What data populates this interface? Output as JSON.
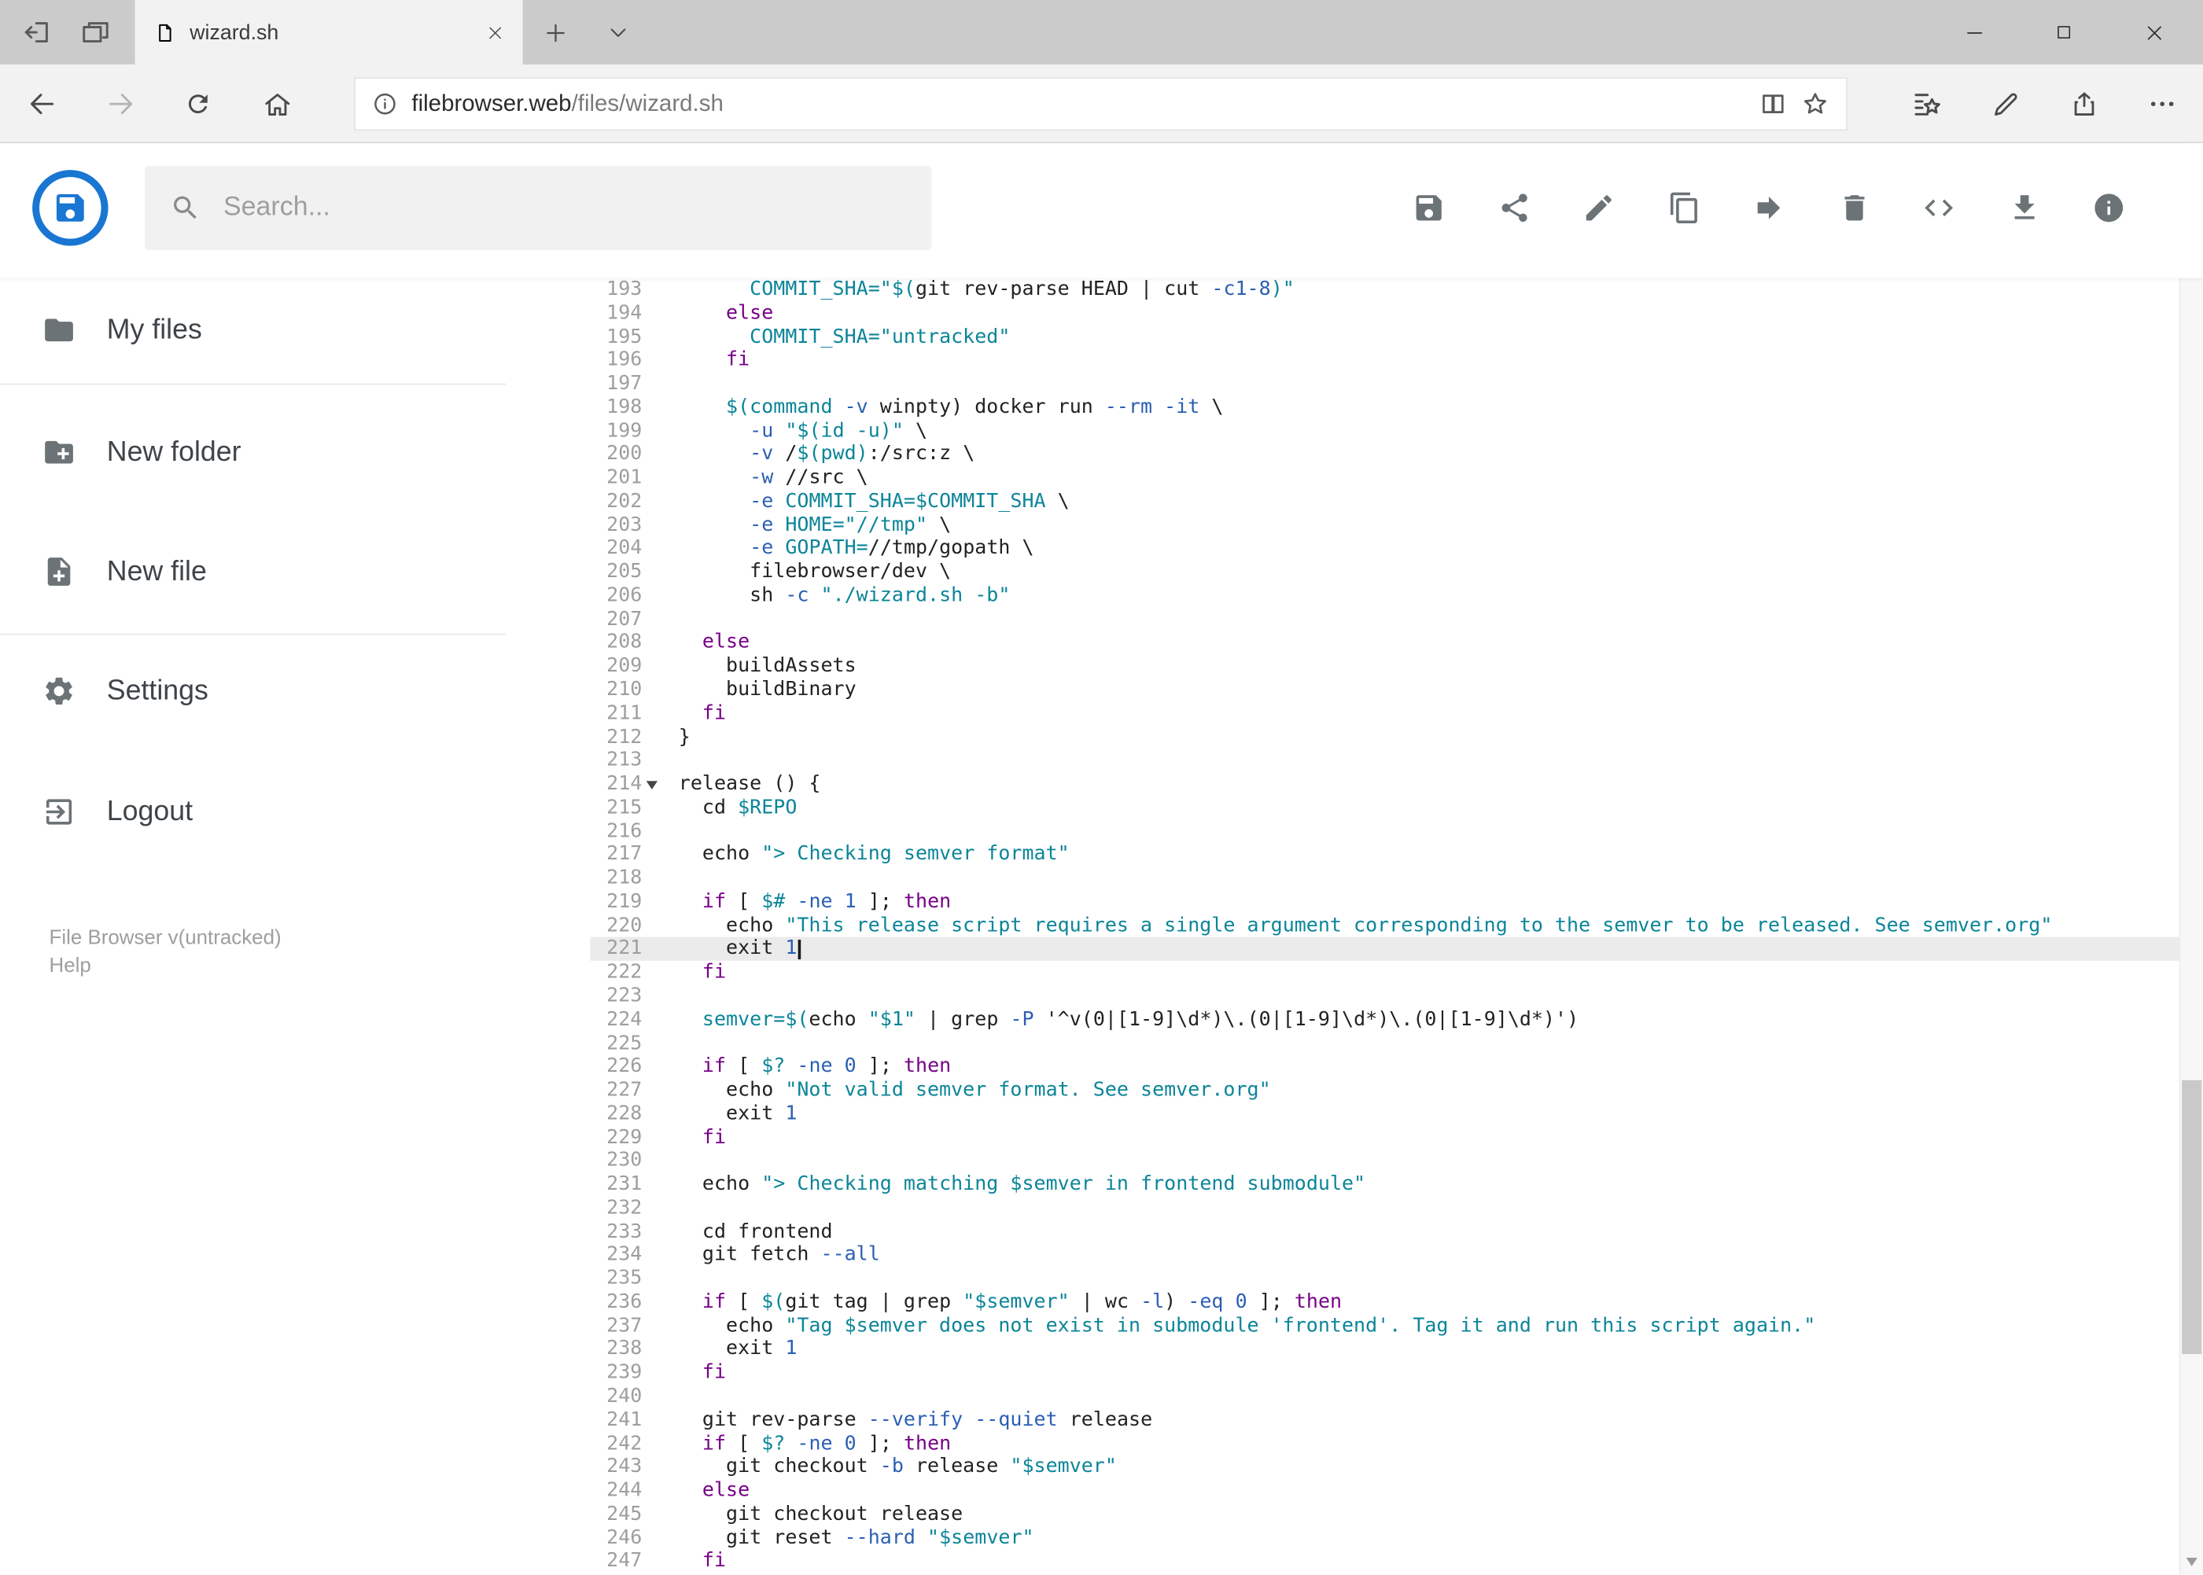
{
  "window": {
    "tab_title": "wizard.sh",
    "control_icons": [
      "minimize",
      "maximize",
      "close"
    ]
  },
  "browser": {
    "url_host": "filebrowser.web",
    "url_path": "/files/wizard.sh",
    "nav_icons": [
      "back",
      "forward",
      "refresh",
      "home"
    ],
    "urlbar_icons": [
      "page-info",
      "reading-view",
      "favorite-star"
    ],
    "action_icons": [
      "hub",
      "web-note",
      "share",
      "more"
    ],
    "tabstrip_icons": [
      "set-tabs-aside",
      "tab-preview",
      "new-tab",
      "tab-list-chevron"
    ]
  },
  "app": {
    "logo_color": "#1976d2",
    "search": {
      "placeholder": "Search..."
    },
    "toolbar_icons": [
      "save",
      "share",
      "rename",
      "copy",
      "move",
      "delete",
      "raw-editor",
      "download",
      "info"
    ],
    "sidebar": {
      "items": [
        {
          "icon": "folder",
          "label": "My files"
        },
        {
          "icon": "new-folder",
          "label": "New folder"
        },
        {
          "icon": "new-file",
          "label": "New file"
        },
        {
          "icon": "settings",
          "label": "Settings"
        },
        {
          "icon": "logout",
          "label": "Logout"
        }
      ],
      "footer": {
        "version": "File Browser v(untracked)",
        "help": "Help"
      }
    }
  },
  "editor": {
    "language": "shell",
    "active_line": 221,
    "fold_marker_line": 214,
    "colors": {
      "plain": "#222222",
      "keyword": "#770088",
      "string": "#0c8599",
      "variable": "#0c8599",
      "attribute": "#2b5fb3",
      "number": "#2b5fb3",
      "gutter": "#9e9e9e",
      "active_line_bg": "#ebebeb"
    },
    "lines": [
      {
        "n": 193,
        "s": [
          [
            "p",
            "      "
          ],
          [
            "v",
            "COMMIT_SHA="
          ],
          [
            "s",
            "\"$("
          ],
          [
            "p",
            "git rev-parse HEAD | cut "
          ],
          [
            "a",
            "-c1-8"
          ],
          [
            "s",
            ")\""
          ]
        ]
      },
      {
        "n": 194,
        "s": [
          [
            "p",
            "    "
          ],
          [
            "k",
            "else"
          ]
        ]
      },
      {
        "n": 195,
        "s": [
          [
            "p",
            "      "
          ],
          [
            "v",
            "COMMIT_SHA="
          ],
          [
            "s",
            "\"untracked\""
          ]
        ]
      },
      {
        "n": 196,
        "s": [
          [
            "p",
            "    "
          ],
          [
            "k",
            "fi"
          ]
        ]
      },
      {
        "n": 197,
        "s": []
      },
      {
        "n": 198,
        "s": [
          [
            "p",
            "    "
          ],
          [
            "v",
            "$(command"
          ],
          [
            "p",
            " "
          ],
          [
            "a",
            "-v"
          ],
          [
            "p",
            " winpty) docker run "
          ],
          [
            "a",
            "--rm"
          ],
          [
            "p",
            " "
          ],
          [
            "a",
            "-it"
          ],
          [
            "p",
            " \\"
          ]
        ]
      },
      {
        "n": 199,
        "s": [
          [
            "p",
            "      "
          ],
          [
            "a",
            "-u"
          ],
          [
            "p",
            " "
          ],
          [
            "s",
            "\"$(id -u)\""
          ],
          [
            "p",
            " \\"
          ]
        ]
      },
      {
        "n": 200,
        "s": [
          [
            "p",
            "      "
          ],
          [
            "a",
            "-v"
          ],
          [
            "p",
            " /"
          ],
          [
            "v",
            "$(pwd)"
          ],
          [
            "p",
            ":/src:z \\"
          ]
        ]
      },
      {
        "n": 201,
        "s": [
          [
            "p",
            "      "
          ],
          [
            "a",
            "-w"
          ],
          [
            "p",
            " //src \\"
          ]
        ]
      },
      {
        "n": 202,
        "s": [
          [
            "p",
            "      "
          ],
          [
            "a",
            "-e"
          ],
          [
            "p",
            " "
          ],
          [
            "v",
            "COMMIT_SHA=$COMMIT_SHA"
          ],
          [
            "p",
            " \\"
          ]
        ]
      },
      {
        "n": 203,
        "s": [
          [
            "p",
            "      "
          ],
          [
            "a",
            "-e"
          ],
          [
            "p",
            " "
          ],
          [
            "v",
            "HOME="
          ],
          [
            "s",
            "\"//tmp\""
          ],
          [
            "p",
            " \\"
          ]
        ]
      },
      {
        "n": 204,
        "s": [
          [
            "p",
            "      "
          ],
          [
            "a",
            "-e"
          ],
          [
            "p",
            " "
          ],
          [
            "v",
            "GOPATH="
          ],
          [
            "p",
            "//tmp/gopath \\"
          ]
        ]
      },
      {
        "n": 205,
        "s": [
          [
            "p",
            "      filebrowser/dev \\"
          ]
        ]
      },
      {
        "n": 206,
        "s": [
          [
            "p",
            "      sh "
          ],
          [
            "a",
            "-c"
          ],
          [
            "p",
            " "
          ],
          [
            "s",
            "\"./wizard.sh -b\""
          ]
        ]
      },
      {
        "n": 207,
        "s": []
      },
      {
        "n": 208,
        "s": [
          [
            "p",
            "  "
          ],
          [
            "k",
            "else"
          ]
        ]
      },
      {
        "n": 209,
        "s": [
          [
            "p",
            "    buildAssets"
          ]
        ]
      },
      {
        "n": 210,
        "s": [
          [
            "p",
            "    buildBinary"
          ]
        ]
      },
      {
        "n": 211,
        "s": [
          [
            "p",
            "  "
          ],
          [
            "k",
            "fi"
          ]
        ]
      },
      {
        "n": 212,
        "s": [
          [
            "p",
            "}"
          ]
        ]
      },
      {
        "n": 213,
        "s": []
      },
      {
        "n": 214,
        "s": [
          [
            "p",
            "release () {"
          ]
        ]
      },
      {
        "n": 215,
        "s": [
          [
            "p",
            "  cd "
          ],
          [
            "v",
            "$REPO"
          ]
        ]
      },
      {
        "n": 216,
        "s": []
      },
      {
        "n": 217,
        "s": [
          [
            "p",
            "  echo "
          ],
          [
            "s",
            "\"> Checking semver format\""
          ]
        ]
      },
      {
        "n": 218,
        "s": []
      },
      {
        "n": 219,
        "s": [
          [
            "p",
            "  "
          ],
          [
            "k",
            "if"
          ],
          [
            "p",
            " [ "
          ],
          [
            "v",
            "$#"
          ],
          [
            "p",
            " "
          ],
          [
            "a",
            "-ne"
          ],
          [
            "p",
            " "
          ],
          [
            "n",
            "1"
          ],
          [
            "p",
            " ]; "
          ],
          [
            "k",
            "then"
          ]
        ]
      },
      {
        "n": 220,
        "s": [
          [
            "p",
            "    echo "
          ],
          [
            "s",
            "\"This release script requires a single argument corresponding to the semver to be released. See semver.org\""
          ]
        ]
      },
      {
        "n": 221,
        "s": [
          [
            "p",
            "    exit "
          ],
          [
            "n",
            "1"
          ]
        ]
      },
      {
        "n": 222,
        "s": [
          [
            "p",
            "  "
          ],
          [
            "k",
            "fi"
          ]
        ]
      },
      {
        "n": 223,
        "s": []
      },
      {
        "n": 224,
        "s": [
          [
            "p",
            "  "
          ],
          [
            "v",
            "semver=$("
          ],
          [
            "p",
            "echo "
          ],
          [
            "s",
            "\"$1\""
          ],
          [
            "p",
            " | grep "
          ],
          [
            "a",
            "-P"
          ],
          [
            "p",
            " '^v(0|[1-9]\\d*)\\.(0|[1-9]\\d*)\\.(0|[1-9]\\d*)')"
          ]
        ]
      },
      {
        "n": 225,
        "s": []
      },
      {
        "n": 226,
        "s": [
          [
            "p",
            "  "
          ],
          [
            "k",
            "if"
          ],
          [
            "p",
            " [ "
          ],
          [
            "v",
            "$?"
          ],
          [
            "p",
            " "
          ],
          [
            "a",
            "-ne"
          ],
          [
            "p",
            " "
          ],
          [
            "n",
            "0"
          ],
          [
            "p",
            " ]; "
          ],
          [
            "k",
            "then"
          ]
        ]
      },
      {
        "n": 227,
        "s": [
          [
            "p",
            "    echo "
          ],
          [
            "s",
            "\"Not valid semver format. See semver.org\""
          ]
        ]
      },
      {
        "n": 228,
        "s": [
          [
            "p",
            "    exit "
          ],
          [
            "n",
            "1"
          ]
        ]
      },
      {
        "n": 229,
        "s": [
          [
            "p",
            "  "
          ],
          [
            "k",
            "fi"
          ]
        ]
      },
      {
        "n": 230,
        "s": []
      },
      {
        "n": 231,
        "s": [
          [
            "p",
            "  echo "
          ],
          [
            "s",
            "\"> Checking matching $semver in frontend submodule\""
          ]
        ]
      },
      {
        "n": 232,
        "s": []
      },
      {
        "n": 233,
        "s": [
          [
            "p",
            "  cd frontend"
          ]
        ]
      },
      {
        "n": 234,
        "s": [
          [
            "p",
            "  git fetch "
          ],
          [
            "a",
            "--all"
          ]
        ]
      },
      {
        "n": 235,
        "s": []
      },
      {
        "n": 236,
        "s": [
          [
            "p",
            "  "
          ],
          [
            "k",
            "if"
          ],
          [
            "p",
            " [ "
          ],
          [
            "v",
            "$("
          ],
          [
            "p",
            "git tag | grep "
          ],
          [
            "s",
            "\"$semver\""
          ],
          [
            "p",
            " | wc "
          ],
          [
            "a",
            "-l"
          ],
          [
            "p",
            ") "
          ],
          [
            "a",
            "-eq"
          ],
          [
            "p",
            " "
          ],
          [
            "n",
            "0"
          ],
          [
            "p",
            " ]; "
          ],
          [
            "k",
            "then"
          ]
        ]
      },
      {
        "n": 237,
        "s": [
          [
            "p",
            "    echo "
          ],
          [
            "s",
            "\"Tag $semver does not exist in submodule 'frontend'. Tag it and run this script again.\""
          ]
        ]
      },
      {
        "n": 238,
        "s": [
          [
            "p",
            "    exit "
          ],
          [
            "n",
            "1"
          ]
        ]
      },
      {
        "n": 239,
        "s": [
          [
            "p",
            "  "
          ],
          [
            "k",
            "fi"
          ]
        ]
      },
      {
        "n": 240,
        "s": []
      },
      {
        "n": 241,
        "s": [
          [
            "p",
            "  git rev-parse "
          ],
          [
            "a",
            "--verify"
          ],
          [
            "p",
            " "
          ],
          [
            "a",
            "--quiet"
          ],
          [
            "p",
            " release"
          ]
        ]
      },
      {
        "n": 242,
        "s": [
          [
            "p",
            "  "
          ],
          [
            "k",
            "if"
          ],
          [
            "p",
            " [ "
          ],
          [
            "v",
            "$?"
          ],
          [
            "p",
            " "
          ],
          [
            "a",
            "-ne"
          ],
          [
            "p",
            " "
          ],
          [
            "n",
            "0"
          ],
          [
            "p",
            " ]; "
          ],
          [
            "k",
            "then"
          ]
        ]
      },
      {
        "n": 243,
        "s": [
          [
            "p",
            "    git checkout "
          ],
          [
            "a",
            "-b"
          ],
          [
            "p",
            " release "
          ],
          [
            "s",
            "\"$semver\""
          ]
        ]
      },
      {
        "n": 244,
        "s": [
          [
            "p",
            "  "
          ],
          [
            "k",
            "else"
          ]
        ]
      },
      {
        "n": 245,
        "s": [
          [
            "p",
            "    git checkout release"
          ]
        ]
      },
      {
        "n": 246,
        "s": [
          [
            "p",
            "    git reset "
          ],
          [
            "a",
            "--hard"
          ],
          [
            "p",
            " "
          ],
          [
            "s",
            "\"$semver\""
          ]
        ]
      },
      {
        "n": 247,
        "s": [
          [
            "p",
            "  "
          ],
          [
            "k",
            "fi"
          ]
        ]
      }
    ]
  }
}
